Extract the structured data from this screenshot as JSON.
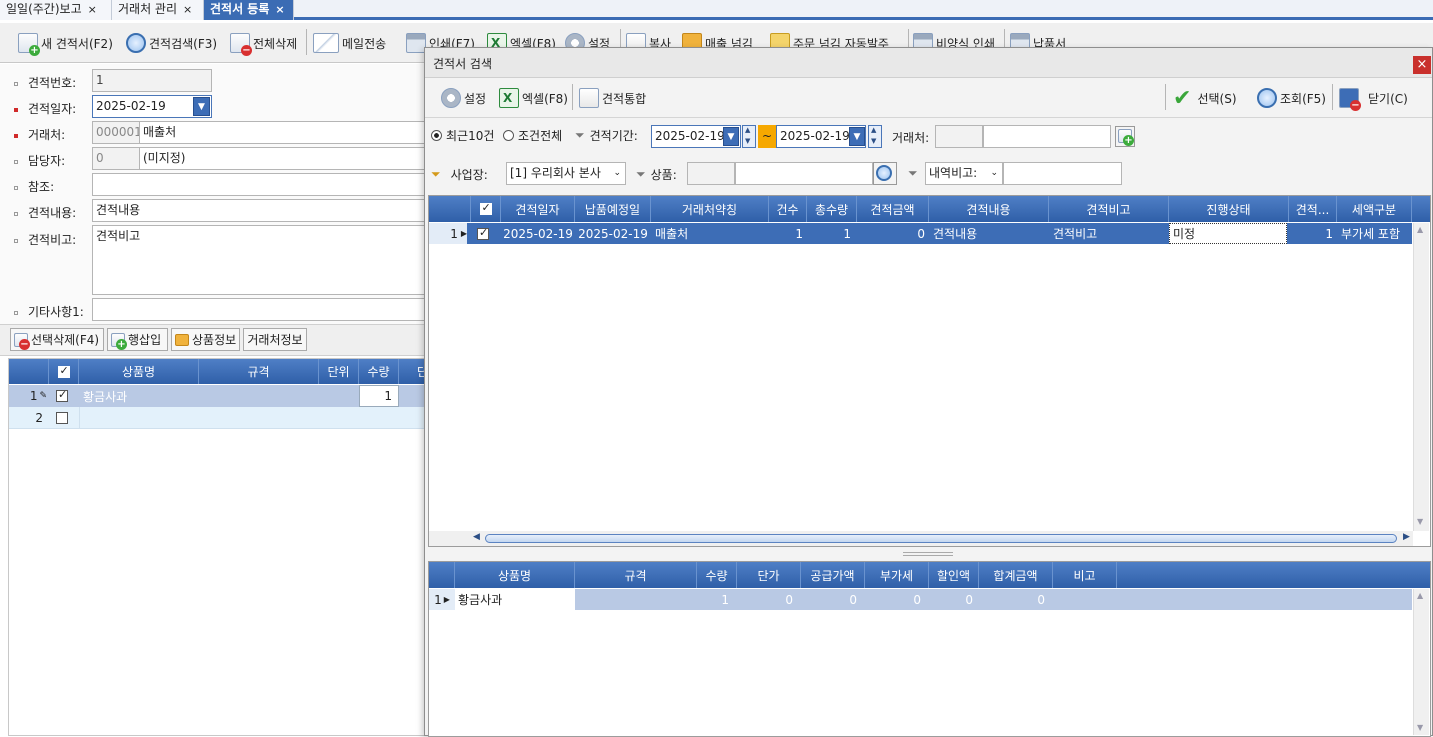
{
  "tabs": [
    {
      "label": "일일(주간)보고",
      "close": "×"
    },
    {
      "label": "거래처 관리",
      "close": "×"
    },
    {
      "label": "견적서 등록",
      "close": "×"
    }
  ],
  "toolbar": {
    "new_quote": "새 견적서(F2)",
    "search_quote": "견적검색(F3)",
    "delete_all": "전체삭제",
    "mail_send": "메일전송",
    "print": "인쇄(F7)",
    "excel": "엑셀(F8)",
    "settings": "설정",
    "copy": "복사",
    "to_sales": "매출 넘김",
    "to_order": "주문 넘김 자동발주",
    "cost_print": "비양식 인쇄",
    "delivery": "납품서"
  },
  "form": {
    "quote_no_label": "견적번호:",
    "quote_no": "1",
    "quote_date_label": "견적일자:",
    "quote_date": "2025-02-19",
    "client_label": "거래처:",
    "client_code": "000001",
    "client_name": "매출처",
    "manager_label": "담당자:",
    "manager_code": "0",
    "manager_name": "(미지정)",
    "ref_label": "참조:",
    "ref_value": "",
    "content_label": "견적내용:",
    "content_value": "견적내용",
    "remark_label": "견적비고:",
    "remark_value": "견적비고",
    "etc_label": "기타사항1:",
    "etc_value": ""
  },
  "detail_toolbar": {
    "delete_selected": "선택삭제(F4)",
    "insert_row": "행삽입",
    "product_info": "상품정보",
    "client_info": "거래처정보"
  },
  "detail_grid": {
    "columns": [
      "상품명",
      "규격",
      "단위",
      "수량",
      "단"
    ],
    "rows": [
      {
        "no": "1",
        "checked": true,
        "product": "황금사과",
        "spec": "",
        "unit": "",
        "qty": "1"
      },
      {
        "no": "2",
        "checked": false,
        "product": "",
        "spec": "",
        "unit": "",
        "qty": ""
      }
    ]
  },
  "dialog": {
    "title": "견적서 검색",
    "close": "×",
    "toolbar": {
      "settings": "설정",
      "excel": "엑셀(F8)",
      "merge": "견적통합",
      "select": "선택(S)",
      "query": "조회(F5)",
      "close": "닫기(C)"
    },
    "filter": {
      "recent10": "최근10건",
      "all": "조건전체",
      "period_label": "견적기간:",
      "date_from": "2025-02-19",
      "tilde": "~",
      "date_to": "2025-02-19",
      "client_label": "거래처:",
      "client_code": "",
      "client_name": "",
      "site_label": "사업장:",
      "site_value": "[1] 우리회사 본사",
      "product_label": "상품:",
      "product_code": "",
      "product_name": "",
      "remark_select": "내역비고:",
      "remark_value": ""
    },
    "grid": {
      "columns": [
        "견적일자",
        "납품예정일",
        "거래처약칭",
        "건수",
        "총수량",
        "견적금액",
        "견적내용",
        "견적비고",
        "진행상태",
        "견적...",
        "세액구분"
      ],
      "rows": [
        {
          "no": "1",
          "checked": true,
          "date": "2025-02-19",
          "delivery": "2025-02-19",
          "client": "매출처",
          "count": "1",
          "total_qty": "1",
          "amount": "0",
          "content": "견적내용",
          "remark": "견적비고",
          "status": "미정",
          "q": "1",
          "tax": "부가세 포함"
        }
      ]
    },
    "sub_grid": {
      "columns": [
        "상품명",
        "규격",
        "수량",
        "단가",
        "공급가액",
        "부가세",
        "할인액",
        "합계금액",
        "비고"
      ],
      "rows": [
        {
          "no": "1",
          "product": "황금사과",
          "spec": "",
          "qty": "1",
          "price": "0",
          "supply": "0",
          "vat": "0",
          "discount": "0",
          "total": "0",
          "note": ""
        }
      ]
    }
  },
  "colors": {
    "accent": "#3b6cb4",
    "grid_header": "#3f6fb9",
    "selected_row": "#3d6db6",
    "required_dot": "#d02a2a"
  }
}
